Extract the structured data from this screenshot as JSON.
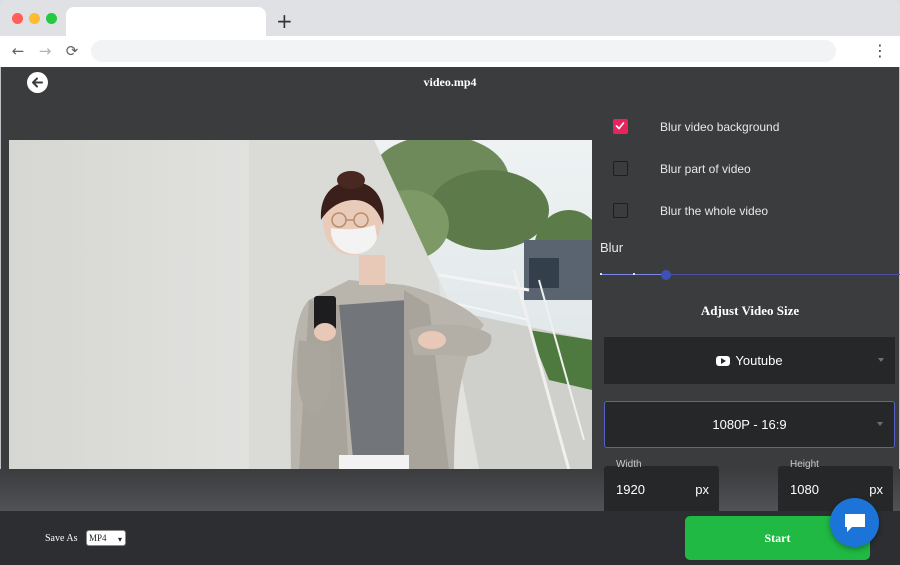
{
  "browser": {
    "new_tab_symbol": "+",
    "menu_symbol": "⋮"
  },
  "app": {
    "file_title": "video.mp4",
    "options": [
      {
        "label": "Blur video background",
        "checked": true
      },
      {
        "label": "Blur part of video",
        "checked": false
      },
      {
        "label": "Blur the whole video",
        "checked": false
      }
    ],
    "blur_label": "Blur",
    "blur_level_fraction": 0.22,
    "section_title": "Adjust Video Size",
    "platform_select": {
      "value": "Youtube",
      "icon": "youtube-icon"
    },
    "resolution_select": {
      "value": "1080P - 16:9"
    },
    "width_field": {
      "label": "Width",
      "value": "1920",
      "unit": "px"
    },
    "height_field": {
      "label": "Height",
      "value": "1080",
      "unit": "px"
    },
    "save_as_label": "Save As",
    "format_value": "MP4",
    "start_label": "Start"
  },
  "colors": {
    "accent_check": "#e8245e",
    "start_button": "#1fb943",
    "chat_button": "#1d74d8",
    "slider": "#3f51b5"
  }
}
